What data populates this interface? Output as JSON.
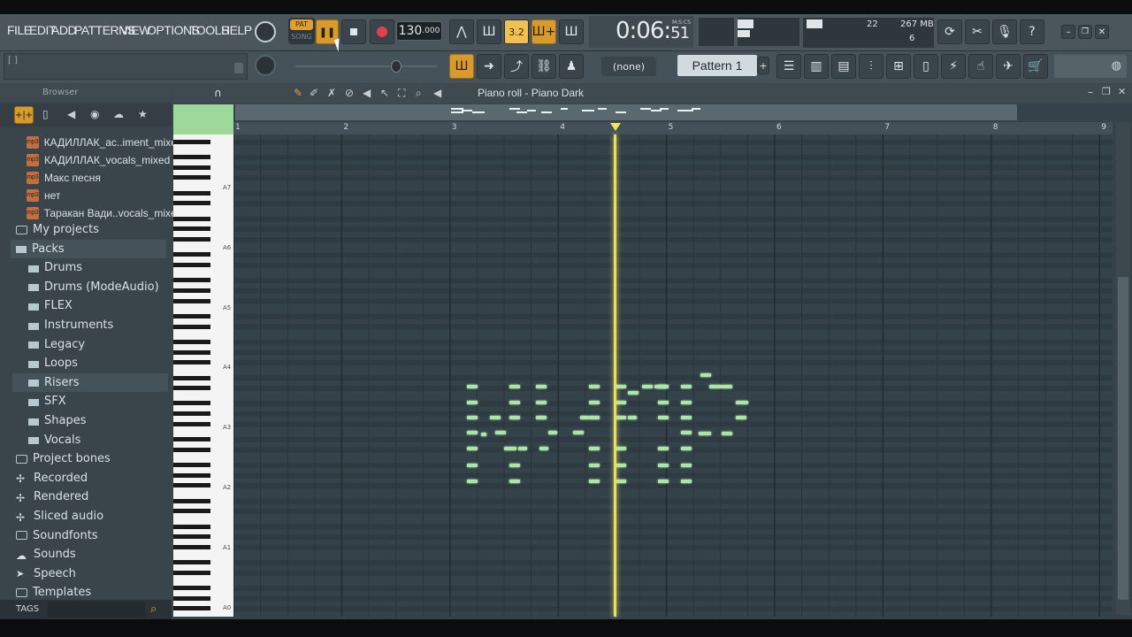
{
  "menu": [
    "FILE",
    "EDIT",
    "ADD",
    "PATTERNS",
    "VIEW",
    "OPTIONS",
    "TOOLS",
    "HELP"
  ],
  "transport": {
    "pat_label": "PAT",
    "song_label": "SONG",
    "tempo": "130",
    "tempo_decimals": ".000"
  },
  "time": {
    "main": "0:06",
    "sub": "51",
    "label": "M:S:CS"
  },
  "cpu": {
    "cores": "22",
    "memory": "267 MB",
    "voices": "6"
  },
  "pattern": {
    "snap": "(none)",
    "name": "Pattern 1"
  },
  "hint_bar": "[ ]",
  "browser": {
    "title": "Browser",
    "files": [
      "КАДИЛЛАК_ас..iment_mixed",
      "КАДИЛЛАК_vocals_mixed",
      "Макс песня",
      "нет",
      "Таракан Вади..vocals_mixed"
    ],
    "items": [
      {
        "label": "My projects",
        "kind": "folder",
        "indent": 0
      },
      {
        "label": "Packs",
        "kind": "pack",
        "indent": 0,
        "selected": true
      },
      {
        "label": "Drums",
        "kind": "pack",
        "indent": 1
      },
      {
        "label": "Drums (ModeAudio)",
        "kind": "pack",
        "indent": 1
      },
      {
        "label": "FLEX",
        "kind": "pack",
        "indent": 1
      },
      {
        "label": "Instruments",
        "kind": "pack",
        "indent": 1
      },
      {
        "label": "Legacy",
        "kind": "pack",
        "indent": 1
      },
      {
        "label": "Loops",
        "kind": "pack",
        "indent": 1
      },
      {
        "label": "Risers",
        "kind": "pack",
        "indent": 1,
        "selected": true
      },
      {
        "label": "SFX",
        "kind": "pack",
        "indent": 1
      },
      {
        "label": "Shapes",
        "kind": "pack",
        "indent": 1
      },
      {
        "label": "Vocals",
        "kind": "pack",
        "indent": 1
      },
      {
        "label": "Project bones",
        "kind": "folder",
        "indent": 0
      },
      {
        "label": "Recorded",
        "kind": "star",
        "indent": 0
      },
      {
        "label": "Rendered",
        "kind": "star",
        "indent": 0
      },
      {
        "label": "Sliced audio",
        "kind": "star",
        "indent": 0
      },
      {
        "label": "Soundfonts",
        "kind": "folder",
        "indent": 0
      },
      {
        "label": "Sounds",
        "kind": "cloud",
        "indent": 0
      },
      {
        "label": "Speech",
        "kind": "speech",
        "indent": 0
      },
      {
        "label": "Templates",
        "kind": "folder",
        "indent": 0
      }
    ],
    "tags_label": "TAGS"
  },
  "piano_roll": {
    "title": "Piano roll - Piano Dark",
    "bars": [
      "1",
      "2",
      "3",
      "4",
      "5",
      "6",
      "7",
      "8",
      "9"
    ],
    "octaves": [
      "A7",
      "A6",
      "A5",
      "A4",
      "A3",
      "A2",
      "A1",
      "A0"
    ]
  }
}
